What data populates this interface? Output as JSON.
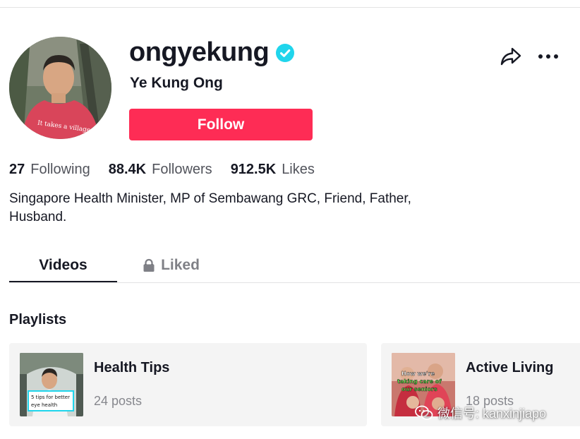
{
  "profile": {
    "username": "ongyekung",
    "display_name": "Ye Kung Ong",
    "verified": true,
    "avatar_shirt_text": "It takes a village",
    "follow_label": "Follow",
    "accent_color": "#fe2c55",
    "verified_color": "#20d5ec"
  },
  "stats": {
    "following_count": "27",
    "following_label": "Following",
    "followers_count": "88.4K",
    "followers_label": "Followers",
    "likes_count": "912.5K",
    "likes_label": "Likes"
  },
  "bio": "Singapore Health Minister, MP of Sembawang GRC, Friend, Father, Husband.",
  "tabs": [
    {
      "label": "Videos",
      "active": true
    },
    {
      "label": "Liked",
      "active": false,
      "locked": true
    }
  ],
  "playlists": {
    "heading": "Playlists",
    "items": [
      {
        "title": "Health Tips",
        "count": "24 posts",
        "thumb_caption_line1": "5 tips for better",
        "thumb_caption_line2": "eye health"
      },
      {
        "title": "Active Living",
        "count": "18 posts",
        "thumb_caption_line1": "How we're",
        "thumb_caption_line2": "taking care of",
        "thumb_caption_line3": "our seniors"
      }
    ]
  },
  "icons": {
    "share": "share-icon",
    "more": "more-icon",
    "verified": "verified-badge-icon",
    "lock": "lock-icon"
  },
  "watermark": {
    "text": "微信号: kanxinjiapo"
  }
}
